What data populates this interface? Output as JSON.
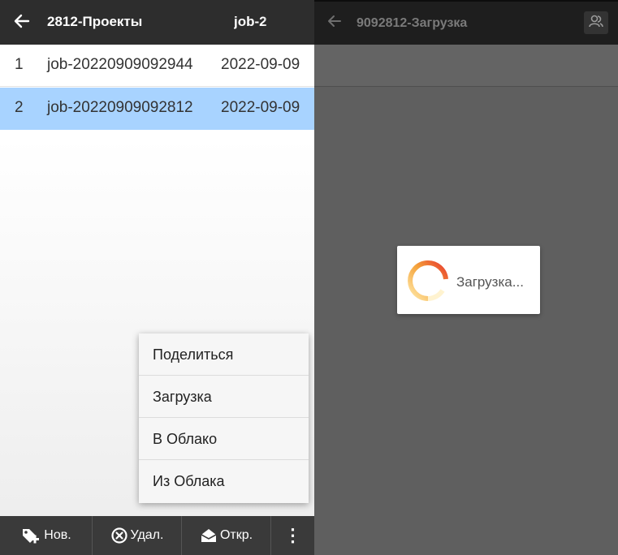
{
  "left": {
    "header": {
      "title": "2812-Проекты",
      "title_second": "job-2"
    },
    "rows": [
      {
        "num": "1",
        "name": "job-20220909092944",
        "date": "2022-09-09",
        "selected": false
      },
      {
        "num": "2",
        "name": "job-20220909092812",
        "date": "2022-09-09",
        "selected": true
      }
    ],
    "menu": {
      "items": [
        "Поделиться",
        "Загрузка",
        "В Облако",
        "Из Облака"
      ]
    },
    "toolbar": {
      "new_label": "Нов.",
      "delete_label": "Удал.",
      "open_label": "Откр.",
      "more_label": "⋮"
    }
  },
  "right": {
    "header": {
      "title": "9092812-Загрузка"
    },
    "loading_text": "Загрузка..."
  },
  "colors": {
    "header_bg": "#2d2d2d",
    "selected_row": "#a8d3ff",
    "overlay": "#5f5f5f",
    "spinner_start": "#e8392e",
    "spinner_end": "#ffe08a"
  },
  "icons": [
    "back-arrow-icon",
    "tag-add-icon",
    "cancel-circle-icon",
    "open-envelope-icon",
    "more-vert-icon",
    "users-icon"
  ]
}
